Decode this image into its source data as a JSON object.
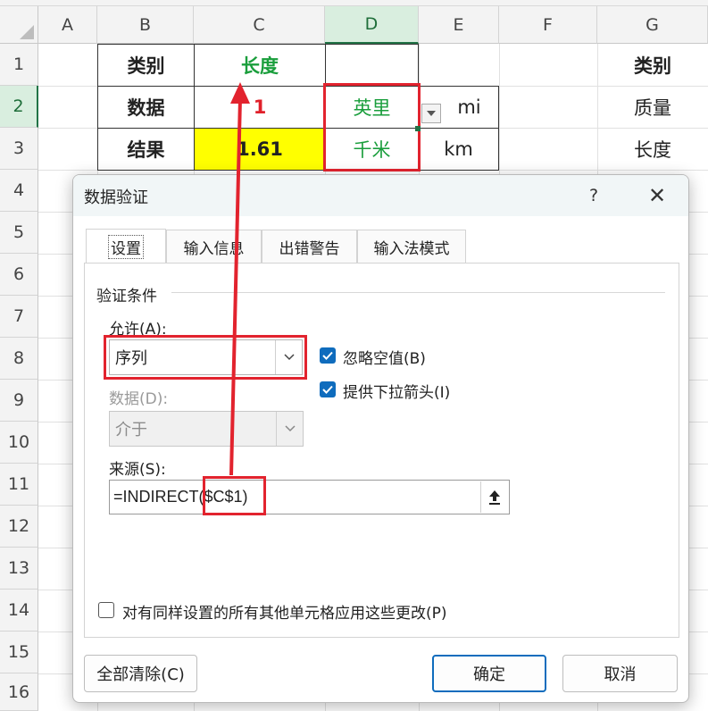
{
  "sheet": {
    "columns": [
      "A",
      "B",
      "C",
      "D",
      "E",
      "F",
      "G"
    ],
    "rows": [
      "1",
      "2",
      "3",
      "4",
      "5",
      "6",
      "7",
      "8",
      "9",
      "10",
      "11",
      "12",
      "13",
      "14",
      "15",
      "16"
    ],
    "cells": {
      "B1": "类别",
      "C1": "长度",
      "B2": "数据",
      "C2": "1",
      "D2": "英里",
      "E2": "mi",
      "G2": "质量",
      "B3": "结果",
      "C3": "1.61",
      "D3": "千米",
      "E3": "km",
      "G3": "长度",
      "G1": "类别"
    },
    "colors": {
      "green_text": "#1a9e3c",
      "red_text": "#e0202a",
      "yellow_fill": "#ffff00",
      "annotation_red": "#e2232e"
    }
  },
  "dialog": {
    "title": "数据验证",
    "help_label": "?",
    "close_label": "✕",
    "tabs": [
      "设置",
      "输入信息",
      "出错警告",
      "输入法模式"
    ],
    "active_tab": "设置",
    "section_title": "验证条件",
    "allow_label": "允许(A):",
    "allow_value": "序列",
    "data_label": "数据(D):",
    "data_value": "介于",
    "ignore_blank_label": "忽略空值(B)",
    "ignore_blank_checked": true,
    "dropdown_arrow_label": "提供下拉箭头(I)",
    "dropdown_arrow_checked": true,
    "source_label": "来源(S):",
    "source_value": "=INDIRECT($C$1)",
    "apply_all_label": "对有同样设置的所有其他单元格应用这些更改(P)",
    "apply_all_checked": false,
    "clear_all_button": "全部清除(C)",
    "ok_button": "确定",
    "cancel_button": "取消"
  }
}
